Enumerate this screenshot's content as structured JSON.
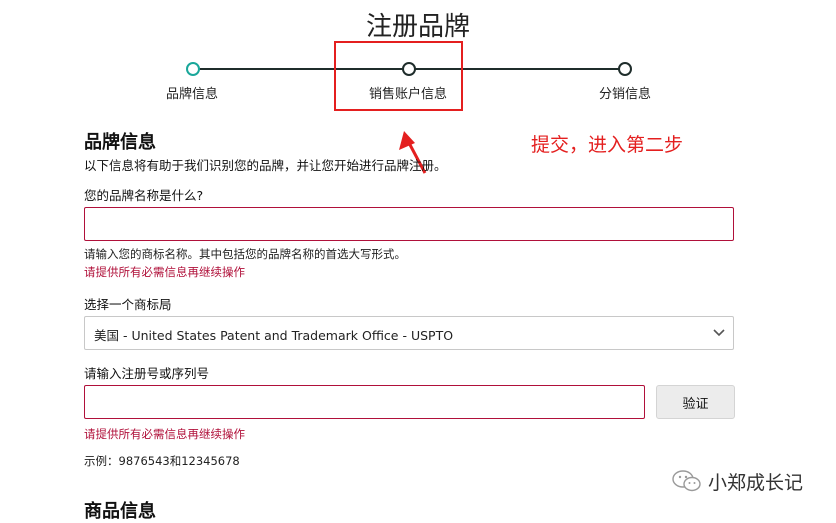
{
  "page": {
    "title": "注册品牌"
  },
  "stepper": {
    "steps": [
      {
        "label": "品牌信息",
        "active": true
      },
      {
        "label": "销售账户信息",
        "active": false
      },
      {
        "label": "分销信息",
        "active": false
      }
    ],
    "line_color": "#1f2d2b",
    "active_color": "#1aa79a"
  },
  "annotation": {
    "text": "提交，进入第二步",
    "color": "#e41f1f"
  },
  "brand_section": {
    "title": "品牌信息",
    "description": "以下信息将有助于我们识别您的品牌，并让您开始进行品牌注册。",
    "brand_name": {
      "label": "您的品牌名称是什么?",
      "value": "",
      "hint": "请输入您的商标名称。其中包括您的品牌名称的首选大写形式。",
      "error": "请提供所有必需信息再继续操作"
    },
    "trademark_office": {
      "label": "选择一个商标局",
      "selected": "美国 - United States Patent and Trademark Office - USPTO"
    },
    "registration_number": {
      "label": "请输入注册号或序列号",
      "value": "",
      "verify_label": "验证",
      "error": "请提供所有必需信息再继续操作",
      "example": "示例：9876543和12345678"
    }
  },
  "product_section": {
    "title": "商品信息"
  },
  "watermark": {
    "text": "小郑成长记",
    "icon": "wechat-icon"
  },
  "colors": {
    "error": "#b0103a",
    "highlight": "#e41f1f"
  }
}
